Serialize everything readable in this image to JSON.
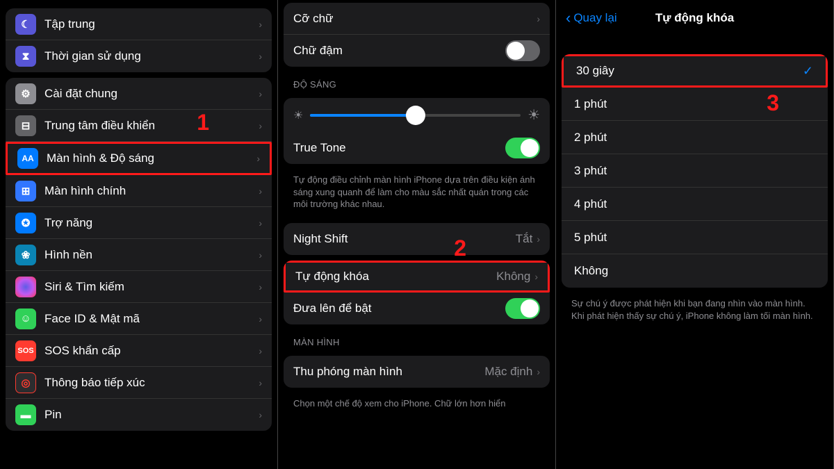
{
  "panel1": {
    "rows_top": [
      {
        "icon": "moon",
        "bg": "bg-purple",
        "label": "Tập trung"
      },
      {
        "icon": "hourglass",
        "bg": "bg-purple",
        "label": "Thời gian sử dụng"
      }
    ],
    "rows_main": [
      {
        "icon": "gear",
        "bg": "bg-gray",
        "label": "Cài đặt chung"
      },
      {
        "icon": "switches",
        "bg": "bg-gray2",
        "label": "Trung tâm điều khiển"
      },
      {
        "icon": "AA",
        "bg": "bg-blue",
        "label": "Màn hình & Độ sáng",
        "highlight": true
      },
      {
        "icon": "grid",
        "bg": "bg-blue2",
        "label": "Màn hình chính"
      },
      {
        "icon": "access",
        "bg": "bg-blue",
        "label": "Trợ năng"
      },
      {
        "icon": "flower",
        "bg": "bg-cyan",
        "label": "Hình nền"
      },
      {
        "icon": "siri",
        "bg": "bg-black",
        "label": "Siri & Tìm kiếm"
      },
      {
        "icon": "face",
        "bg": "bg-green",
        "label": "Face ID & Mật mã"
      },
      {
        "icon": "SOS",
        "bg": "bg-red",
        "label": "SOS khẩn cấp"
      },
      {
        "icon": "exposure",
        "bg": "bg-dark",
        "label": "Thông báo tiếp xúc"
      },
      {
        "icon": "battery",
        "bg": "bg-green",
        "label": "Pin"
      }
    ],
    "step": "1"
  },
  "panel2": {
    "text_size": "Cỡ chữ",
    "bold_text": "Chữ đậm",
    "brightness_header": "ĐỘ SÁNG",
    "true_tone": "True Tone",
    "true_tone_desc": "Tự động điều chỉnh màn hình iPhone dựa trên điều kiện ánh sáng xung quanh để làm cho màu sắc nhất quán trong các môi trường khác nhau.",
    "night_shift": "Night Shift",
    "night_shift_val": "Tắt",
    "auto_lock": "Tự động khóa",
    "auto_lock_val": "Không",
    "raise_wake": "Đưa lên để bật",
    "display_header": "MÀN HÌNH",
    "zoom": "Thu phóng màn hình",
    "zoom_val": "Mặc định",
    "zoom_desc": "Chọn một chế độ xem cho iPhone. Chữ lớn hơn hiển",
    "step": "2"
  },
  "panel3": {
    "back": "Quay lại",
    "title": "Tự động khóa",
    "options": [
      "30 giây",
      "1 phút",
      "2 phút",
      "3 phút",
      "4 phút",
      "5 phút",
      "Không"
    ],
    "selected": 0,
    "footnote": "Sự chú ý được phát hiện khi bạn đang nhìn vào màn hình. Khi phát hiện thấy sự chú ý, iPhone không làm tối màn hình.",
    "step": "3"
  }
}
